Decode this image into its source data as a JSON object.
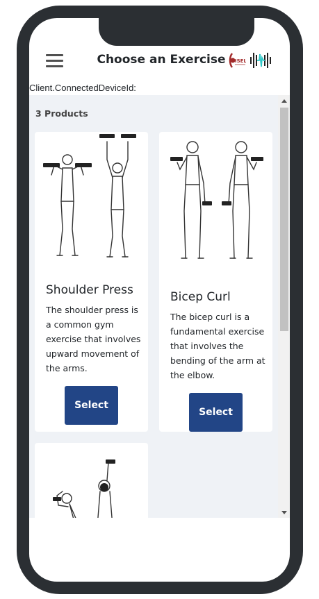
{
  "header": {
    "title": "Choose an Exercise",
    "logo_text": "ISEL"
  },
  "device": {
    "label": "Client.ConnectedDeviceId:"
  },
  "catalog": {
    "count_label": "3 Products",
    "products": [
      {
        "name": "Shoulder Press",
        "description": "The shoulder press is a common gym exercise that involves upward movement of the arms.",
        "button": "Select"
      },
      {
        "name": "Bicep Curl",
        "description": "The bicep curl is a fundamental exercise that involves the bending of the arm at the elbow.",
        "button": "Select"
      }
    ]
  },
  "colors": {
    "button": "#224586",
    "frame": "#2b2f33",
    "content_bg": "#eff2f6",
    "logo_red": "#a22a2a",
    "wave_cyan": "#2fc8c8"
  },
  "icons": [
    "hamburger-menu-icon",
    "isel-logo",
    "soundwave-logo-icon",
    "scroll-up-arrow-icon",
    "scroll-down-arrow-icon"
  ]
}
